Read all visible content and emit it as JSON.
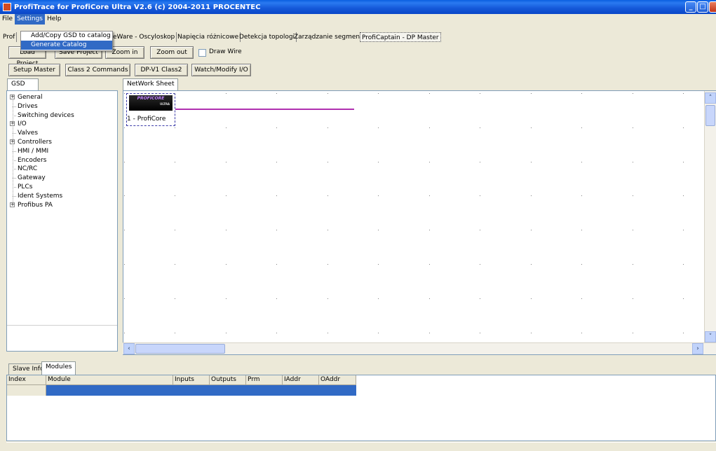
{
  "window": {
    "title": "ProfiTrace for ProfiCore Ultra V2.6 (c) 2004-2011 PROCENTEC"
  },
  "menubar": {
    "file": "File",
    "settings": "Settings",
    "help": "Help"
  },
  "settings_menu": {
    "items": [
      "Add/Copy GSD to catalog",
      "Generate Catalog"
    ]
  },
  "top_tabs": [
    "Prof",
    "eWare - Oscyloskop",
    "Napięcia różnicowe",
    "Detekcja topologi",
    "Zarządzanie segmentami",
    "ProfiCaptain - DP Master"
  ],
  "toolbar1": {
    "load_project": "Load Project",
    "save_project": "Save Project",
    "zoom_in": "Zoom in",
    "zoom_out": "Zoom out",
    "draw_wire": "Draw Wire"
  },
  "toolbar2": {
    "setup_master": "Setup Master",
    "class2_commands": "Class 2 Commands",
    "dpv1_class2": "DP-V1 Class2",
    "watch_modify_io": "Watch/Modify I/O"
  },
  "left_panel": {
    "tab": "GSD",
    "tree": [
      {
        "label": "General",
        "expandable": true
      },
      {
        "label": "Drives",
        "expandable": false
      },
      {
        "label": "Switching devices",
        "expandable": false
      },
      {
        "label": "I/O",
        "expandable": true
      },
      {
        "label": "Valves",
        "expandable": false
      },
      {
        "label": "Controllers",
        "expandable": true
      },
      {
        "label": "HMI / MMI",
        "expandable": false
      },
      {
        "label": "Encoders",
        "expandable": false
      },
      {
        "label": "NC/RC",
        "expandable": false
      },
      {
        "label": "Gateway",
        "expandable": false
      },
      {
        "label": "PLCs",
        "expandable": false
      },
      {
        "label": "Ident Systems",
        "expandable": false
      },
      {
        "label": "Profibus PA",
        "expandable": true
      }
    ]
  },
  "network": {
    "tab": "NetWork Sheet",
    "node_label": "1 - ProfiCore",
    "logo_text": "PROFICORE",
    "logo_sub": "ULTRA",
    "bus_color": "#b030b0"
  },
  "bottom": {
    "tabs": [
      "Slave Info",
      "Modules"
    ],
    "columns": [
      "Index",
      "Module",
      "Inputs",
      "Outputs",
      "Prm",
      "IAddr",
      "OAddr"
    ]
  },
  "colors": {
    "titlebar": "#0a5fe0",
    "selection": "#316ac5",
    "face": "#ece9d8"
  }
}
